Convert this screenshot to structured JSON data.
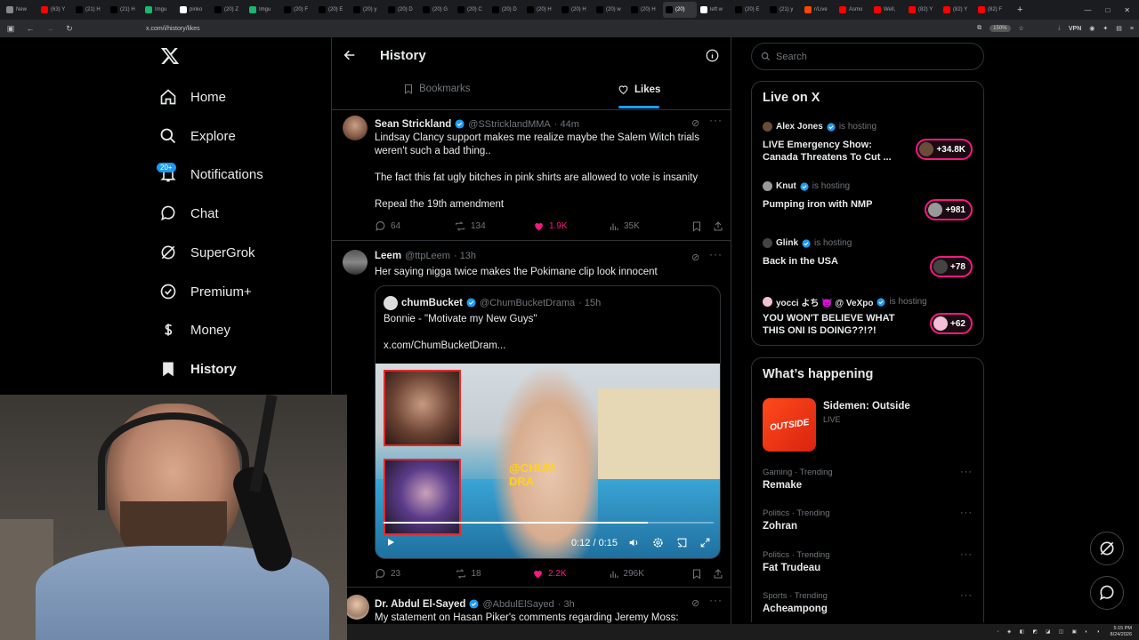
{
  "browser": {
    "tabs": [
      {
        "label": "New",
        "color": "#888"
      },
      {
        "label": "(63) Y",
        "color": "#f00"
      },
      {
        "label": "(21) H",
        "color": "#000"
      },
      {
        "label": "(21) H",
        "color": "#000"
      },
      {
        "label": "Imgu",
        "color": "#1bb76e"
      },
      {
        "label": "pinko",
        "color": "#fff"
      },
      {
        "label": "(20) Z",
        "color": "#000"
      },
      {
        "label": "Imgu",
        "color": "#1bb76e"
      },
      {
        "label": "(20) F",
        "color": "#000"
      },
      {
        "label": "(20) E",
        "color": "#000"
      },
      {
        "label": "(20) y",
        "color": "#000"
      },
      {
        "label": "(20) D",
        "color": "#000"
      },
      {
        "label": "(20) G",
        "color": "#000"
      },
      {
        "label": "(20) C",
        "color": "#000"
      },
      {
        "label": "(20) D",
        "color": "#000"
      },
      {
        "label": "(20) H",
        "color": "#000"
      },
      {
        "label": "(20) H",
        "color": "#000"
      },
      {
        "label": "(20) w",
        "color": "#000"
      },
      {
        "label": "(20) H",
        "color": "#000"
      },
      {
        "label": "(20)",
        "color": "#000",
        "active": true
      },
      {
        "label": "left w",
        "color": "#fff"
      },
      {
        "label": "(20) E",
        "color": "#000"
      },
      {
        "label": "(21) y",
        "color": "#000"
      },
      {
        "label": "r/Live",
        "color": "#ff4500"
      },
      {
        "label": "Asmo",
        "color": "#f00"
      },
      {
        "label": "Well,",
        "color": "#f00"
      },
      {
        "label": "(82) Y",
        "color": "#f00"
      },
      {
        "label": "(82) Y",
        "color": "#f00"
      },
      {
        "label": "(82) F",
        "color": "#f00"
      }
    ],
    "url": "x.com/i/history/likes",
    "zoom": "150%",
    "vpn": "VPN"
  },
  "nav": {
    "items": [
      {
        "label": "Home",
        "icon": "home-icon"
      },
      {
        "label": "Explore",
        "icon": "search-icon"
      },
      {
        "label": "Notifications",
        "icon": "bell-icon"
      },
      {
        "label": "Chat",
        "icon": "chat-icon"
      },
      {
        "label": "SuperGrok",
        "icon": "grok-icon"
      },
      {
        "label": "Premium+",
        "icon": "premium-icon"
      },
      {
        "label": "Money",
        "icon": "money-icon"
      },
      {
        "label": "History",
        "icon": "history-icon"
      }
    ],
    "notif_badge": "20+"
  },
  "header": {
    "title": "History"
  },
  "tabs": {
    "bookmarks": "Bookmarks",
    "likes": "Likes"
  },
  "posts": [
    {
      "name": "Sean Strickland",
      "handle": "@SStricklandMMA",
      "time": "· 44m",
      "lines": [
        "Lindsay Clancy support makes me realize maybe the Salem Witch trials",
        "weren't such a bad thing..",
        "",
        "The fact this fat ugly bitches in pink shirts are allowed to vote is insanity",
        "",
        "Repeal the 19th amendment"
      ],
      "replies": "64",
      "reposts": "134",
      "likes": "1.9K",
      "views": "35K"
    },
    {
      "name": "Leem",
      "handle": "@ttpLeem",
      "time": "· 13h",
      "lines": [
        "Her saying nigga twice makes the Pokimane clip look innocent"
      ],
      "quote": {
        "name": "chumBucket",
        "handle": "@ChumBucketDrama",
        "time": "· 15h",
        "text": "Bonnie - \"Motivate my New Guys\"",
        "link": "x.com/ChumBucketDram...",
        "watermark": "@CHUM DRA"
      },
      "video_time": "0:12 / 0:15",
      "progress": 0.8,
      "replies": "23",
      "reposts": "18",
      "likes": "2.2K",
      "views": "296K"
    },
    {
      "name": "Dr. Abdul El-Sayed",
      "handle": "@AbdulElSayed",
      "time": "· 3h",
      "lines": [
        "My statement on Hasan Piker's comments regarding Jeremy Moss:"
      ]
    }
  ],
  "search": {
    "placeholder": "Search"
  },
  "live": {
    "title": "Live on X",
    "items": [
      {
        "host": "Alex Jones",
        "hosting": "is hosting",
        "title": "LIVE Emergency Show: Canada Threatens To Cut ...",
        "count": "+34.8K"
      },
      {
        "host": "Knut",
        "hosting": "is hosting",
        "title": "Pumping iron with NMP",
        "count": "+981"
      },
      {
        "host": "Glink",
        "hosting": "is hosting",
        "title": "Back in the USA",
        "count": "+78"
      },
      {
        "host": "yocci よち 👿 @ VeXpo",
        "hosting": "is hosting",
        "title": "YOU WON'T BELIEVE WHAT THIS ONI IS DOING??!?!",
        "count": "+62"
      }
    ]
  },
  "happening": {
    "title": "What’s happening",
    "event": {
      "name": "Sidemen: Outside",
      "status": "LIVE",
      "thumb": "OUTSIDE"
    },
    "trends": [
      {
        "cat": "Gaming · Trending",
        "name": "Remake"
      },
      {
        "cat": "Politics · Trending",
        "name": "Zohran"
      },
      {
        "cat": "Politics · Trending",
        "name": "Fat Trudeau"
      },
      {
        "cat": "Sports · Trending",
        "name": "Acheampong"
      }
    ]
  },
  "taskbar": {
    "time": "5:15 PM",
    "date": "8/24/2026"
  },
  "colors": {
    "accent": "#1d9bf0",
    "like": "#f91880",
    "muted": "#71767b",
    "border": "#2f3336"
  }
}
